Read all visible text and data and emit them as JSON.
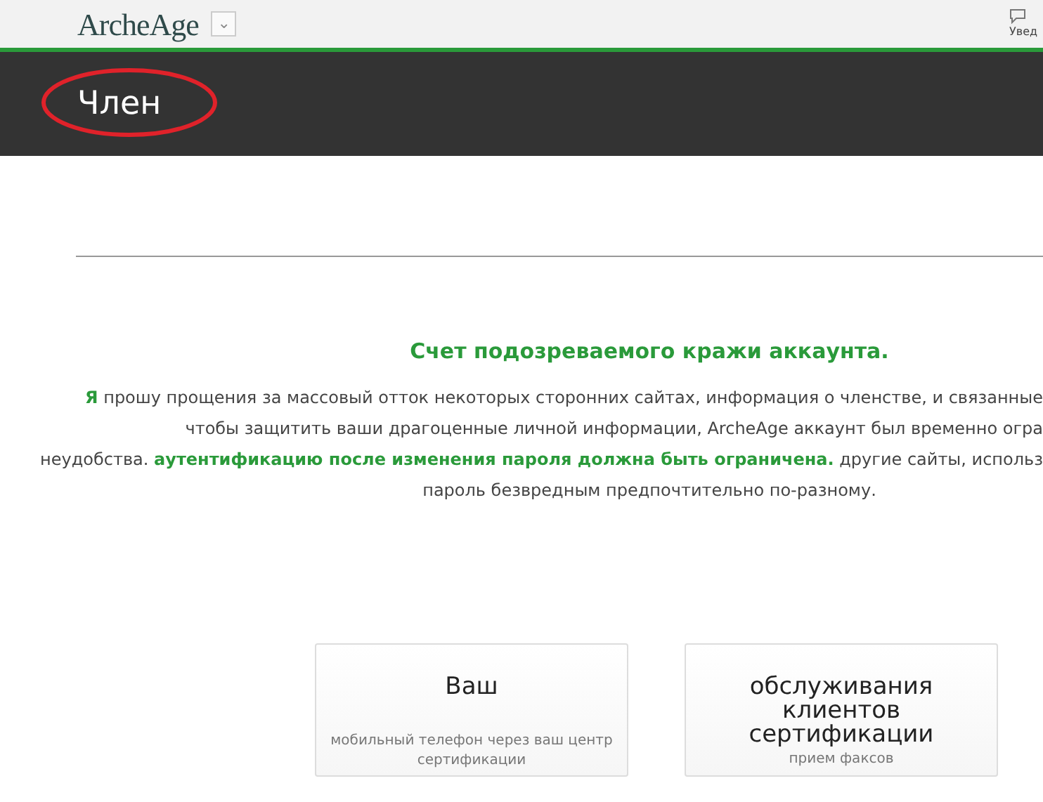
{
  "topbar": {
    "logo": "ArcheAge",
    "dropdown_glyph": "⌄",
    "notifications_label": "Увед"
  },
  "page_header": {
    "title": "Член",
    "circled": true
  },
  "notice": {
    "heading": "Счет подозреваемого кражи аккаунта.",
    "lines": [
      "**Я** прошу прощения за массовый отток некоторых сторонних сайтах, информация о членстве, и связанные",
      "чтобы защитить ваши драгоценные личной информации, ArcheAge аккаунт был временно огра",
      "неудобства. **аутентификацию после изменения пароля должна быть ограничена.** другие сайты, использ",
      "пароль безвредным предпочтительно по-разному."
    ]
  },
  "options": [
    {
      "title": "Ваш",
      "caption": "мобильный телефон через ваш центр сертификации"
    },
    {
      "title": "обслуживания клиентов сертификации",
      "caption": "прием факсов"
    }
  ]
}
